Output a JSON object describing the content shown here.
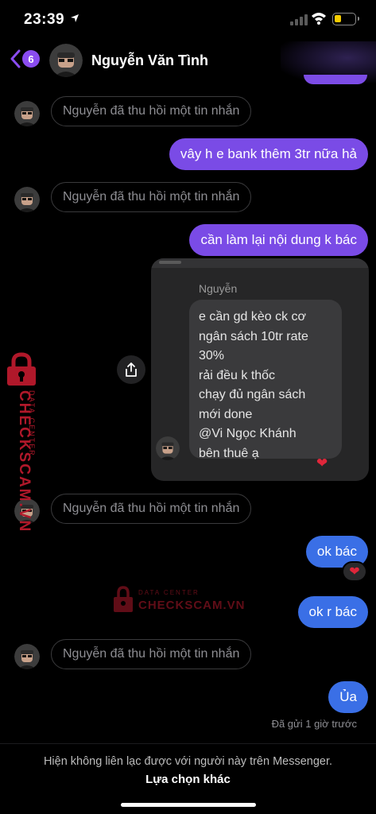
{
  "status_bar": {
    "time": "23:39"
  },
  "header": {
    "unread_count": "6",
    "contact_name": "Nguyễn Văn Tình"
  },
  "messages": {
    "recalled_text": "Nguyễn đã thu hồi một tin nhắn",
    "out_1": "vây h e bank thêm 3tr nữa hả",
    "out_2": "cần làm lại nội dung k bác",
    "out_3": "ok bác",
    "out_4": "ok r bác",
    "out_5": "Ủa"
  },
  "image_message": {
    "sender": "Nguyễn",
    "lines": [
      "e cần gd kèo ck cơ",
      "ngân sách 10tr rate",
      "30%",
      "rải đều k thốc",
      "chạy đủ ngân sách",
      "mới done",
      "@Vi Ngọc Khánh",
      "bên thuê ạ"
    ]
  },
  "reaction": "heart",
  "sent_status": "Đã gửi 1 giờ trước",
  "watermark": {
    "brand": "CHECKSCAM.VN",
    "tagline": "DATA CENTER"
  },
  "footer": {
    "note": "Hiện không liên lạc được với người này trên Messenger.",
    "other_option": "Lựa chọn khác"
  },
  "colors": {
    "accent_purple": "#7a4be6",
    "accent_blue": "#3a6fe6",
    "watermark_red": "#b0182a"
  }
}
